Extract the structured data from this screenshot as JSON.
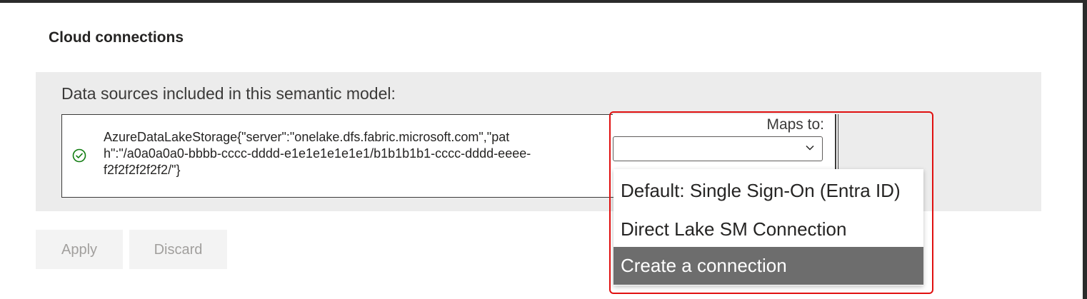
{
  "section": {
    "title": "Cloud connections"
  },
  "panel": {
    "heading": "Data sources included in this semantic model:"
  },
  "data_source": {
    "status_icon": "check-circle-icon",
    "status_color": "#107c10",
    "text": "AzureDataLakeStorage{\"server\":\"onelake.dfs.fabric.microsoft.com\",\"path\":\"/a0a0a0a0-bbbb-cccc-dddd-e1e1e1e1e1e1/b1b1b1b1-cccc-dddd-eeee-f2f2f2f2f2f2/\"}"
  },
  "mapping": {
    "label": "Maps to:",
    "selected_value": "",
    "options": [
      "Default: Single Sign-On (Entra ID)",
      "Direct Lake SM Connection",
      "Create a connection"
    ],
    "highlighted_option": "Create a connection"
  },
  "buttons": {
    "apply": "Apply",
    "discard": "Discard"
  },
  "colors": {
    "annotation_border": "#e01010",
    "highlight_bg": "#6d6d6d",
    "panel_bg": "#ececec"
  }
}
